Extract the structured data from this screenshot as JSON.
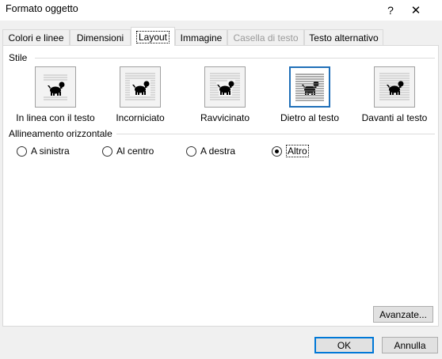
{
  "window": {
    "title": "Formato oggetto",
    "help": "?",
    "close": "✕"
  },
  "tabs": [
    {
      "label": "Colori e linee",
      "state": "normal"
    },
    {
      "label": "Dimensioni",
      "state": "normal"
    },
    {
      "label": "Layout",
      "state": "active"
    },
    {
      "label": "Immagine",
      "state": "normal"
    },
    {
      "label": "Casella di testo",
      "state": "disabled"
    },
    {
      "label": "Testo alternativo",
      "state": "normal"
    }
  ],
  "layout": {
    "style_group": "Stile",
    "wrap_options": [
      {
        "label": "In linea con il testo",
        "icon": "inline-wrap-icon",
        "selected": false
      },
      {
        "label": "Incorniciato",
        "icon": "square-wrap-icon",
        "selected": false
      },
      {
        "label": "Ravvicinato",
        "icon": "tight-wrap-icon",
        "selected": false
      },
      {
        "label": "Dietro al testo",
        "icon": "behind-text-icon",
        "selected": true
      },
      {
        "label": "Davanti al testo",
        "icon": "in-front-text-icon",
        "selected": false
      }
    ],
    "align_group": "Allineamento orizzontale",
    "alignments": [
      {
        "label": "A sinistra",
        "checked": false
      },
      {
        "label": "Al centro",
        "checked": false
      },
      {
        "label": "A destra",
        "checked": false
      },
      {
        "label": "Altro",
        "checked": true
      }
    ],
    "advanced_button": "Avanzate..."
  },
  "footer": {
    "ok": "OK",
    "cancel": "Annulla"
  },
  "colors": {
    "selection_border": "#1f6fb8",
    "default_button_border": "#0078d7",
    "disabled_text": "#9a9a9a"
  }
}
